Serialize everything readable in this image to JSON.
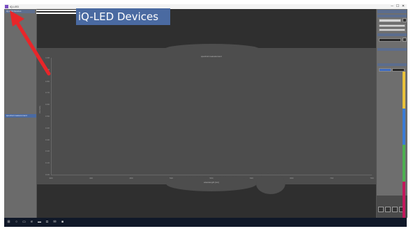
{
  "window": {
    "title": "iQ-LED",
    "min_glyph": "─",
    "max_glyph": "☐",
    "close_glyph": "✕"
  },
  "left_panel": {
    "header": "iQ-LED Devices",
    "selected_item": "spectral measurement"
  },
  "chart_data": {
    "type": "line",
    "title": "spectral measurement",
    "xlabel": "wavelength [nm]",
    "ylabel": "intensity",
    "x_ticks": [
      "380",
      "430",
      "480",
      "530",
      "580",
      "630",
      "680",
      "730",
      "780"
    ],
    "y_ticks": [
      "1.00",
      "0.90",
      "0.80",
      "0.70",
      "0.60",
      "0.50",
      "0.40",
      "0.30",
      "0.20",
      "0.10",
      "0.00"
    ],
    "series": [],
    "xlim": [
      380,
      780
    ],
    "ylim": [
      0,
      1
    ],
    "grid": false
  },
  "annotation": {
    "label": "iQ-LED Devices",
    "arrow_color": "#e8262a",
    "banner_color": "#4a6aa1"
  },
  "right_panel": {
    "strip_colors": [
      "#e9c23a",
      "#3a7bd5",
      "#4caf50",
      "#c2185b"
    ]
  },
  "taskbar": {
    "icons": [
      "windows-icon",
      "search-icon",
      "task-view-icon",
      "edge-icon",
      "folder-icon",
      "store-icon",
      "mail-icon",
      "app-icon"
    ],
    "glyphs": [
      "⊞",
      "○",
      "▭",
      "e",
      "▬",
      "◘",
      "✉",
      "■"
    ]
  }
}
